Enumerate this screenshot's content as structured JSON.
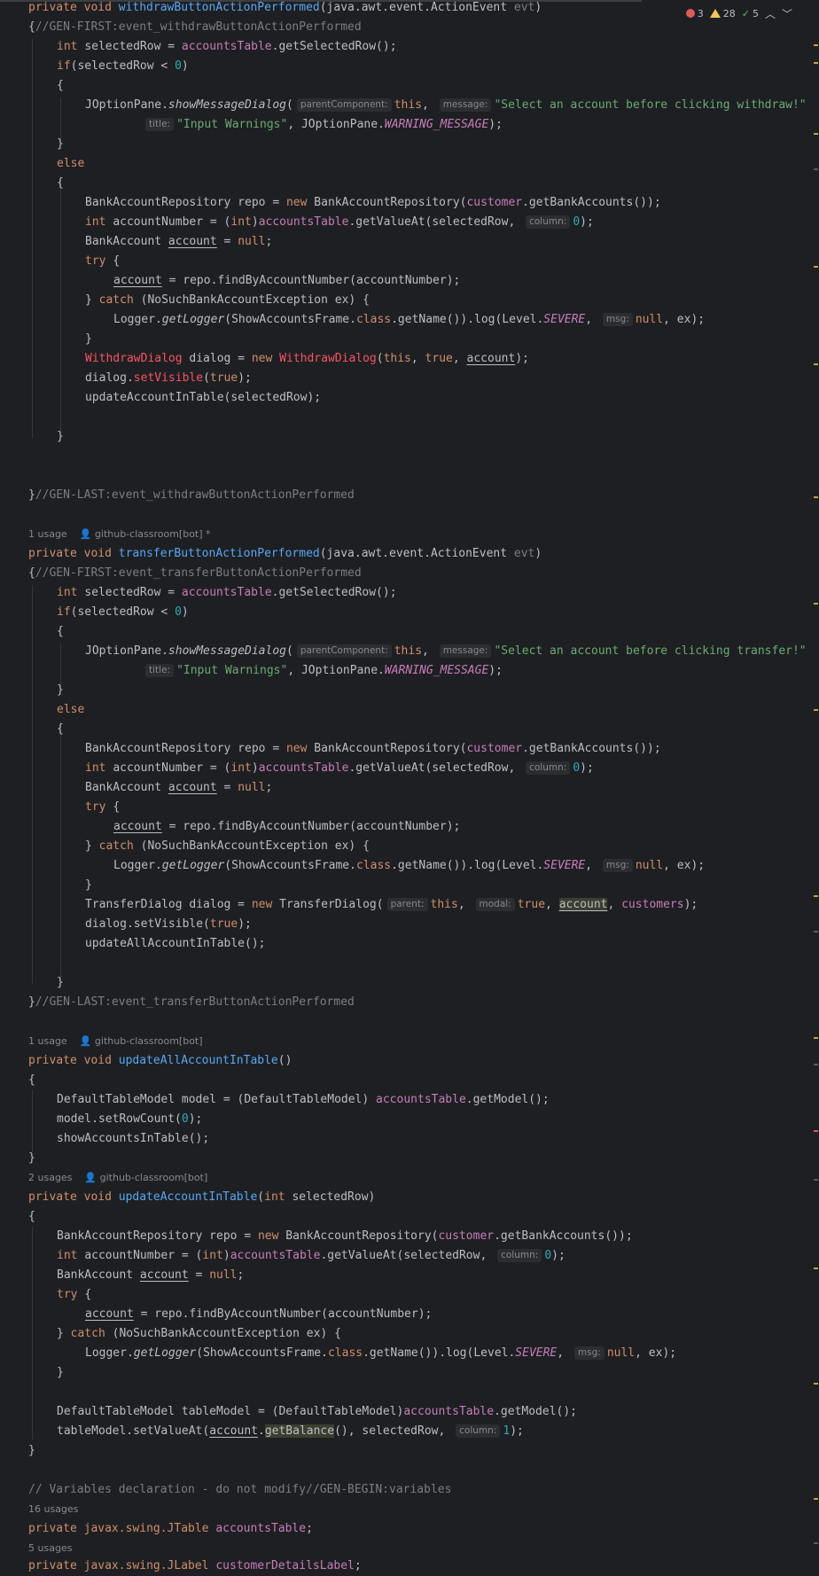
{
  "status": {
    "errors": "3",
    "warnings": "28",
    "weak_warnings": "5"
  },
  "hints": {
    "h1": {
      "usages": "1 usage",
      "author": "github-classroom[bot] *"
    },
    "h2": {
      "usages": "1 usage",
      "author": "github-classroom[bot]"
    },
    "h3": {
      "usages": "2 usages",
      "author": "github-classroom[bot]"
    },
    "h4": {
      "usages": "16 usages"
    },
    "h5": {
      "usages": "5 usages"
    }
  },
  "inlays": {
    "parentComponent": "parentComponent:",
    "message": "message:",
    "title": "title:",
    "column": "column:",
    "msg": "msg:",
    "parent": "parent:",
    "modal": "modal:"
  },
  "code": {
    "l01": [
      "private void ",
      "withdrawButtonActionPerformed",
      "(java.awt.event.ActionEvent ",
      "evt",
      ")"
    ],
    "l02": [
      "{",
      "//GEN-FIRST:event_withdrawButtonActionPerformed"
    ],
    "l03": [
      "int ",
      "selectedRow = ",
      "accountsTable",
      ".getSelectedRow();"
    ],
    "l04": [
      "if",
      "(selectedRow < ",
      "0",
      ")"
    ],
    "l05": [
      "{"
    ],
    "l06": [
      "JOptionPane.",
      "showMessageDialog",
      "(",
      "this",
      ", ",
      "\"Select an account before clicking withdraw!\""
    ],
    "l07": [
      "\"Input Warnings\"",
      ", JOptionPane.",
      "WARNING_MESSAGE",
      ");"
    ],
    "l08": [
      "}"
    ],
    "l09": [
      "else"
    ],
    "l10": [
      "{"
    ],
    "l11": [
      "BankAccountRepository repo = ",
      "new ",
      "BankAccountRepository(",
      "customer",
      ".getBankAccounts());"
    ],
    "l12": [
      "int ",
      "accountNumber = (",
      "int",
      ")",
      "accountsTable",
      ".getValueAt(selectedRow, ",
      "0",
      ");"
    ],
    "l13": [
      "BankAccount ",
      "account",
      " = ",
      "null",
      ";"
    ],
    "l14": [
      "try ",
      "{"
    ],
    "l15": [
      "account",
      " = repo.findByAccountNumber(accountNumber);"
    ],
    "l16": [
      "} ",
      "catch ",
      "(NoSuchBankAccountException ex) {"
    ],
    "l17": [
      "Logger.",
      "getLogger",
      "(ShowAccountsFrame.",
      "class",
      ".getName()).log(Level.",
      "SEVERE",
      ", ",
      "null",
      ", ex);"
    ],
    "l18": [
      "}"
    ],
    "l19": [
      "WithdrawDialog",
      " dialog = ",
      "new ",
      "WithdrawDialog",
      "(",
      "this",
      ", ",
      "true",
      ", ",
      "account",
      ");"
    ],
    "l20": [
      "dialog.",
      "setVisible",
      "(",
      "true",
      ");"
    ],
    "l21": [
      "updateAccountInTable(selectedRow);"
    ],
    "l22": [
      "}"
    ],
    "l23": [
      "}",
      "//GEN-LAST:event_withdrawButtonActionPerformed"
    ],
    "t01": [
      "private void ",
      "transferButtonActionPerformed",
      "(java.awt.event.ActionEvent ",
      "evt",
      ")"
    ],
    "t02": [
      "{",
      "//GEN-FIRST:event_transferButtonActionPerformed"
    ],
    "t03": [
      "int ",
      "selectedRow = ",
      "accountsTable",
      ".getSelectedRow();"
    ],
    "t04": [
      "if",
      "(selectedRow < ",
      "0",
      ")"
    ],
    "t05": [
      "{"
    ],
    "t06": [
      "JOptionPane.",
      "showMessageDialog",
      "(",
      "this",
      ", ",
      "\"Select an account before clicking transfer!\""
    ],
    "t07": [
      "\"Input Warnings\"",
      ", JOptionPane.",
      "WARNING_MESSAGE",
      ");"
    ],
    "t08": [
      "}"
    ],
    "t09": [
      "else"
    ],
    "t10": [
      "{"
    ],
    "t11": [
      "BankAccountRepository repo = ",
      "new ",
      "BankAccountRepository(",
      "customer",
      ".getBankAccounts());"
    ],
    "t12": [
      "int ",
      "accountNumber = (",
      "int",
      ")",
      "accountsTable",
      ".getValueAt(selectedRow, ",
      "0",
      ");"
    ],
    "t13": [
      "BankAccount ",
      "account",
      " = ",
      "null",
      ";"
    ],
    "t14": [
      "try ",
      "{"
    ],
    "t15": [
      "account",
      " = repo.findByAccountNumber(accountNumber);"
    ],
    "t16": [
      "} ",
      "catch ",
      "(NoSuchBankAccountException ex) {"
    ],
    "t17": [
      "Logger.",
      "getLogger",
      "(ShowAccountsFrame.",
      "class",
      ".getName()).log(Level.",
      "SEVERE",
      ", ",
      "null",
      ", ex);"
    ],
    "t18": [
      "}"
    ],
    "t19": [
      "TransferDialog dialog = ",
      "new ",
      "TransferDialog(",
      "this",
      ", ",
      "true",
      ", ",
      "account",
      ", ",
      "customers",
      ");"
    ],
    "t20": [
      "dialog.setVisible(",
      "true",
      ");"
    ],
    "t21": [
      "updateAllAccountInTable();"
    ],
    "t22": [
      "}"
    ],
    "t23": [
      "}",
      "//GEN-LAST:event_transferButtonActionPerformed"
    ],
    "u01": [
      "private void ",
      "updateAllAccountInTable",
      "()"
    ],
    "u02": [
      "{"
    ],
    "u03": [
      "DefaultTableModel model = (DefaultTableModel) ",
      "accountsTable",
      ".getModel();"
    ],
    "u04": [
      "model.setRowCount(",
      "0",
      ");"
    ],
    "u05": [
      "showAccountsInTable();"
    ],
    "u06": [
      "}"
    ],
    "v01": [
      "private void ",
      "updateAccountInTable",
      "(",
      "int ",
      "selectedRow)"
    ],
    "v02": [
      "{"
    ],
    "v03": [
      "BankAccountRepository repo = ",
      "new ",
      "BankAccountRepository(",
      "customer",
      ".getBankAccounts());"
    ],
    "v04": [
      "int ",
      "accountNumber = (",
      "int",
      ")",
      "accountsTable",
      ".getValueAt(selectedRow, ",
      "0",
      ");"
    ],
    "v05": [
      "BankAccount ",
      "account",
      " = ",
      "null",
      ";"
    ],
    "v06": [
      "try ",
      "{"
    ],
    "v07": [
      "account",
      " = repo.findByAccountNumber(accountNumber);"
    ],
    "v08": [
      "} ",
      "catch ",
      "(NoSuchBankAccountException ex) {"
    ],
    "v09": [
      "Logger.",
      "getLogger",
      "(ShowAccountsFrame.",
      "class",
      ".getName()).log(Level.",
      "SEVERE",
      ", ",
      "null",
      ", ex);"
    ],
    "v10": [
      "}"
    ],
    "v11": [
      "DefaultTableModel tableModel = (DefaultTableModel)",
      "accountsTable",
      ".getModel();"
    ],
    "v12": [
      "tableModel.setValueAt(",
      "account",
      ".",
      "getBalance",
      "(), selectedRow, ",
      "1",
      ");"
    ],
    "v13": [
      "}"
    ],
    "w01": [
      "// Variables declaration - do not modify//GEN-BEGIN:variables"
    ],
    "w02": [
      "private ",
      "javax.swing.JTable ",
      "accountsTable",
      ";"
    ],
    "w03": [
      "private ",
      "javax.swing.JLabel ",
      "customerDetailsLabel",
      ";"
    ]
  },
  "colors": {
    "background": "#1e1f22",
    "keyword": "#cf8e6d",
    "method": "#56a8f5",
    "field": "#c77dbb",
    "string": "#6aab73",
    "number": "#2aacb8",
    "comment": "#7a7e85",
    "error": "#f75464",
    "error_badge": "#db5c5c",
    "warning_badge": "#f2c55c",
    "ok_badge": "#5fb865"
  },
  "icons": [
    "error-icon",
    "warning-icon",
    "check-icon",
    "chevron-up-icon",
    "chevron-down-icon",
    "person-icon"
  ]
}
